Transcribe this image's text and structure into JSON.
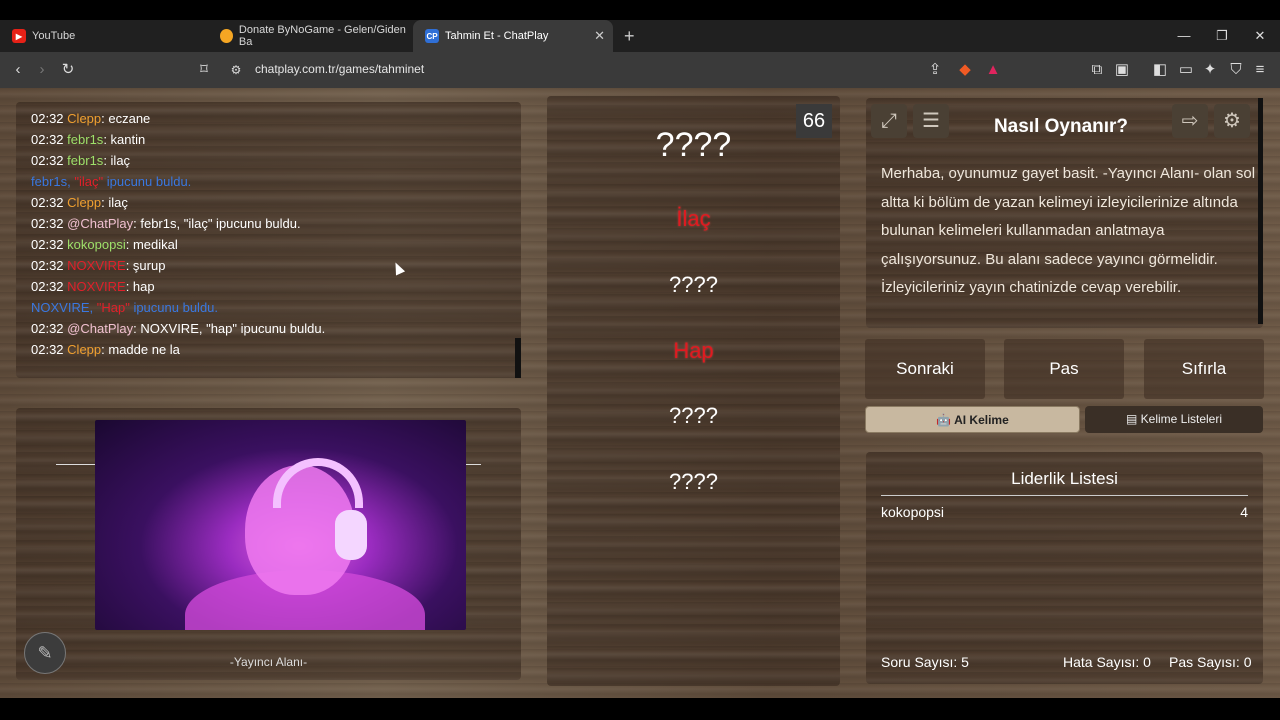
{
  "browser": {
    "tabs": [
      {
        "title": "YouTube",
        "icon": "youtube-icon",
        "color": "#e62117"
      },
      {
        "title": "Donate ByNoGame - Gelen/Giden Ba",
        "icon": "bynogame-icon",
        "color": "#f5a623"
      },
      {
        "title": "Tahmin Et - ChatPlay",
        "icon": "chatplay-icon",
        "color": "#2f6fd6"
      }
    ],
    "url": "chatplay.com.tr/games/tahminet"
  },
  "chat": {
    "lines": [
      {
        "ts": "02:32",
        "user": "Clepp",
        "cls": "u-orange",
        "msg": ": eczane"
      },
      {
        "ts": "02:32",
        "user": "febr1s",
        "cls": "u-green",
        "msg": ": kantin"
      },
      {
        "ts": "02:32",
        "user": "febr1s",
        "cls": "u-green",
        "msg": ": ilaç"
      },
      {
        "ts": "",
        "user": "febr1s,",
        "cls": "u-blue",
        "quoted": " \"ilaç\"",
        "msg": " ipucunu buldu.",
        "system": true
      },
      {
        "ts": "02:32",
        "user": "Clepp",
        "cls": "u-orange",
        "msg": ": ilaç"
      },
      {
        "ts": "02:32",
        "user": "@ChatPlay",
        "cls": "u-pink",
        "msg": ": febr1s, \"ilaç\" ipucunu buldu."
      },
      {
        "ts": "02:32",
        "user": "kokopopsi",
        "cls": "u-green",
        "msg": ": medikal"
      },
      {
        "ts": "02:32",
        "user": "NOXVIRE",
        "cls": "u-red",
        "msg": ": şurup"
      },
      {
        "ts": "02:32",
        "user": "NOXVIRE",
        "cls": "u-red",
        "msg": ": hap"
      },
      {
        "ts": "",
        "user": "NOXVIRE,",
        "cls": "u-blue",
        "quoted": " \"Hap\"",
        "msg": " ipucunu buldu.",
        "system": true
      },
      {
        "ts": "02:32",
        "user": "@ChatPlay",
        "cls": "u-pink",
        "msg": ": NOXVIRE, \"hap\" ipucunu buldu."
      },
      {
        "ts": "02:32",
        "user": "Clepp",
        "cls": "u-orange",
        "msg": ": madde ne la"
      }
    ]
  },
  "streamer": {
    "label": "-Yayıncı Alanı-"
  },
  "game": {
    "timer": "66",
    "main_word": "????",
    "clues": [
      "İlaç",
      "????",
      "Hap",
      "????",
      "????"
    ]
  },
  "howto": {
    "title": "Nasıl Oynanır?",
    "text": "Merhaba, oyunumuz gayet basit. -Yayıncı Alanı- olan sol altta ki bölüm de yazan kelimeyi izleyicilerinize altında bulunan kelimeleri kullanmadan anlatmaya çalışıyorsunuz. Bu alanı sadece yayıncı görmelidir. İzleyicileriniz yayın chatinizde cevap verebilir."
  },
  "controls": {
    "next": "Sonraki",
    "pass": "Pas",
    "reset": "Sıfırla"
  },
  "word_tabs": {
    "ai": "AI Kelime",
    "lists": "Kelime Listeleri"
  },
  "leaderboard": {
    "title": "Liderlik Listesi",
    "rows": [
      {
        "name": "kokopopsi",
        "score": "4"
      }
    ]
  },
  "stats": {
    "questions": "Soru Sayısı: 5",
    "errors": "Hata Sayısı: 0",
    "passes": "Pas Sayısı: 0"
  }
}
